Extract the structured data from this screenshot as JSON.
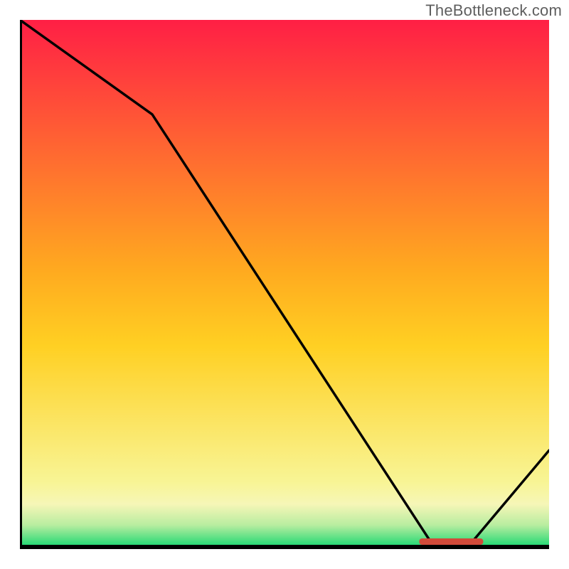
{
  "watermark": "TheBottleneck.com",
  "chart_data": {
    "type": "line",
    "title": "",
    "xlabel": "",
    "ylabel": "",
    "xlim": [
      0,
      100
    ],
    "ylim": [
      0,
      100
    ],
    "grid": false,
    "legend": false,
    "series": [
      {
        "name": "bottleneck-curve",
        "x": [
          0,
          25,
          78,
          85,
          100
        ],
        "y": [
          100,
          82,
          0,
          0,
          18
        ]
      }
    ],
    "annotations": [
      {
        "name": "optimal-range-marker",
        "x": 81.5,
        "y": 0,
        "text": ""
      }
    ],
    "background_gradient": {
      "top_color": "#ff1f45",
      "mid_color": "#ffd023",
      "low_color": "#f6f6b7",
      "bottom_color": "#1fd873"
    },
    "axis_color": "#000000",
    "line_color": "#000000",
    "marker_color": "#d24a3a"
  }
}
